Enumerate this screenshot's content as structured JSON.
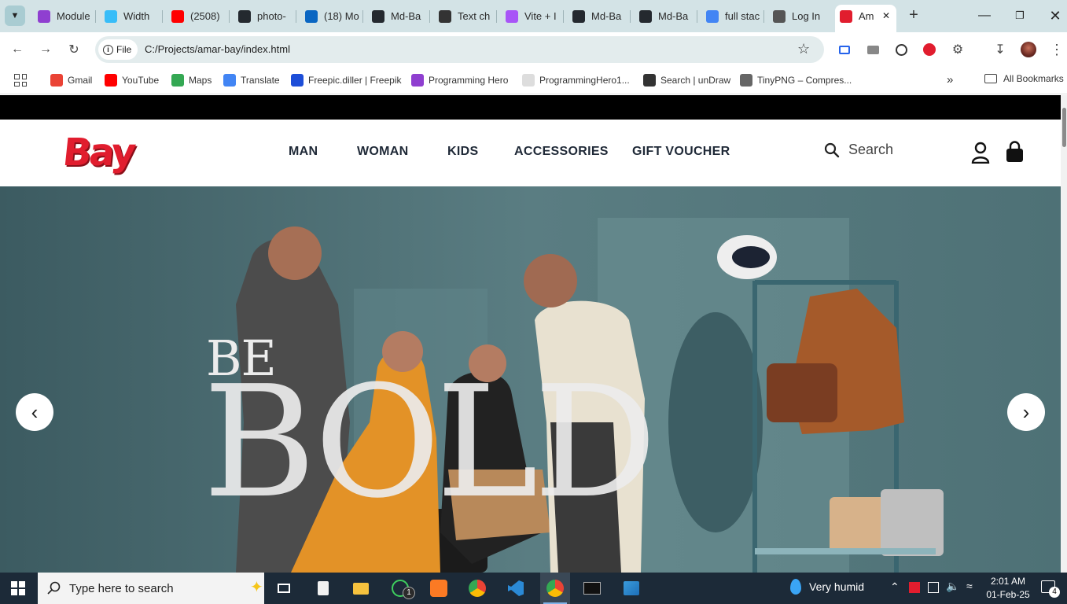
{
  "browser": {
    "tabs": [
      {
        "label": "Module",
        "color": "#8f3fd0"
      },
      {
        "label": "Width",
        "color": "#38bdf8"
      },
      {
        "label": "(2508)",
        "color": "#ff0000"
      },
      {
        "label": "photo-",
        "color": "#24292f"
      },
      {
        "label": "(18) Mo",
        "color": "#0a66c2"
      },
      {
        "label": "Md-Ba",
        "color": "#24292f"
      },
      {
        "label": "Text ch",
        "color": "#333333"
      },
      {
        "label": "Vite + I",
        "color": "#a855f7"
      },
      {
        "label": "Md-Ba",
        "color": "#24292f"
      },
      {
        "label": "Md-Ba",
        "color": "#24292f"
      },
      {
        "label": "full stac",
        "color": "#4285f4"
      },
      {
        "label": "Log In",
        "color": "#555555"
      },
      {
        "label": "Am",
        "color": "#e11d2e"
      }
    ],
    "address": {
      "scheme_label": "File",
      "url": "C:/Projects/amar-bay/index.html"
    },
    "bookmarks": [
      {
        "label": "Gmail",
        "color": "#ea4335"
      },
      {
        "label": "YouTube",
        "color": "#ff0000"
      },
      {
        "label": "Maps",
        "color": "#34a853"
      },
      {
        "label": "Translate",
        "color": "#4285f4"
      },
      {
        "label": "Freepic.diller | Freepik",
        "color": "#1d4ed8"
      },
      {
        "label": "Programming Hero",
        "color": "#8f3fd0"
      },
      {
        "label": "ProgrammingHero1...",
        "color": "#dddddd"
      },
      {
        "label": "Search | unDraw",
        "color": "#333333"
      },
      {
        "label": "TinyPNG – Compres...",
        "color": "#666666"
      }
    ],
    "all_bookmarks_label": "All Bookmarks"
  },
  "site": {
    "logo": "Bay",
    "brand_color": "#e11d2e",
    "nav": [
      "MAN",
      "WOMAN",
      "KIDS",
      "ACCESSORIES",
      "GIFT VOUCHER"
    ],
    "search_placeholder": "Search",
    "hero": {
      "line1": "BE",
      "line2": "BOLD"
    },
    "prev_label": "‹",
    "next_label": "›"
  },
  "taskbar": {
    "search_placeholder": "Type here to search",
    "weather": "Very humid",
    "time": "2:01 AM",
    "date": "01-Feb-25",
    "whatsapp_badge": "1",
    "notification_count": "4"
  }
}
